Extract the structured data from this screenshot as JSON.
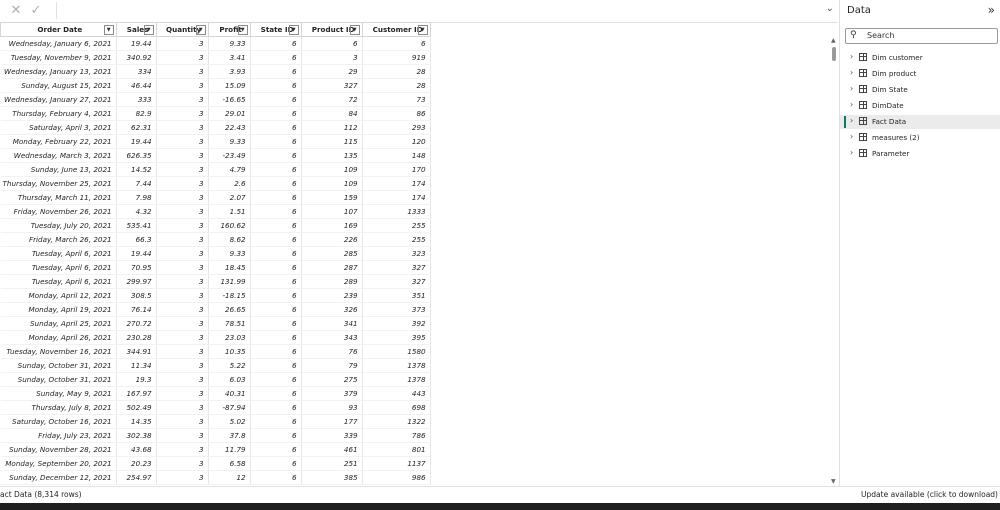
{
  "formula_bar": {
    "cancel_icon": "close-icon",
    "commit_icon": "check-icon",
    "value": ""
  },
  "table": {
    "columns": [
      "Order Date",
      "Sales",
      "Quantity",
      "Profit",
      "State ID",
      "Product ID",
      "Customer ID"
    ],
    "rows": [
      [
        "Wednesday, January 6, 2021",
        "19.44",
        "3",
        "9.33",
        "6",
        "6",
        "6"
      ],
      [
        "Tuesday, November 9, 2021",
        "340.92",
        "3",
        "3.41",
        "6",
        "3",
        "919"
      ],
      [
        "Wednesday, January 13, 2021",
        "334",
        "3",
        "3.93",
        "6",
        "29",
        "28"
      ],
      [
        "Sunday, August 15, 2021",
        "46.44",
        "3",
        "15.09",
        "6",
        "327",
        "28"
      ],
      [
        "Wednesday, January 27, 2021",
        "333",
        "3",
        "-16.65",
        "6",
        "72",
        "73"
      ],
      [
        "Thursday, February 4, 2021",
        "82.9",
        "3",
        "29.01",
        "6",
        "84",
        "86"
      ],
      [
        "Saturday, April 3, 2021",
        "62.31",
        "3",
        "22.43",
        "6",
        "112",
        "293"
      ],
      [
        "Monday, February 22, 2021",
        "19.44",
        "3",
        "9.33",
        "6",
        "115",
        "120"
      ],
      [
        "Wednesday, March 3, 2021",
        "626.35",
        "3",
        "-23.49",
        "6",
        "135",
        "148"
      ],
      [
        "Sunday, June 13, 2021",
        "14.52",
        "3",
        "4.79",
        "6",
        "109",
        "170"
      ],
      [
        "Thursday, November 25, 2021",
        "7.44",
        "3",
        "2.6",
        "6",
        "109",
        "174"
      ],
      [
        "Thursday, March 11, 2021",
        "7.98",
        "3",
        "2.07",
        "6",
        "159",
        "174"
      ],
      [
        "Friday, November 26, 2021",
        "4.32",
        "3",
        "1.51",
        "6",
        "107",
        "1333"
      ],
      [
        "Tuesday, July 20, 2021",
        "535.41",
        "3",
        "160.62",
        "6",
        "169",
        "255"
      ],
      [
        "Friday, March 26, 2021",
        "66.3",
        "3",
        "8.62",
        "6",
        "226",
        "255"
      ],
      [
        "Tuesday, April 6, 2021",
        "19.44",
        "3",
        "9.33",
        "6",
        "285",
        "323"
      ],
      [
        "Tuesday, April 6, 2021",
        "70.95",
        "3",
        "18.45",
        "6",
        "287",
        "327"
      ],
      [
        "Tuesday, April 6, 2021",
        "299.97",
        "3",
        "131.99",
        "6",
        "289",
        "327"
      ],
      [
        "Monday, April 12, 2021",
        "308.5",
        "3",
        "-18.15",
        "6",
        "239",
        "351"
      ],
      [
        "Monday, April 19, 2021",
        "76.14",
        "3",
        "26.65",
        "6",
        "326",
        "373"
      ],
      [
        "Sunday, April 25, 2021",
        "270.72",
        "3",
        "78.51",
        "6",
        "341",
        "392"
      ],
      [
        "Monday, April 26, 2021",
        "230.28",
        "3",
        "23.03",
        "6",
        "343",
        "395"
      ],
      [
        "Tuesday, November 16, 2021",
        "344.91",
        "3",
        "10.35",
        "6",
        "76",
        "1580"
      ],
      [
        "Sunday, October 31, 2021",
        "11.34",
        "3",
        "5.22",
        "6",
        "79",
        "1378"
      ],
      [
        "Sunday, October 31, 2021",
        "19.3",
        "3",
        "6.03",
        "6",
        "275",
        "1378"
      ],
      [
        "Sunday, May 9, 2021",
        "167.97",
        "3",
        "40.31",
        "6",
        "379",
        "443"
      ],
      [
        "Thursday, July 8, 2021",
        "502.49",
        "3",
        "-87.94",
        "6",
        "93",
        "698"
      ],
      [
        "Saturday, October 16, 2021",
        "14.35",
        "3",
        "5.02",
        "6",
        "177",
        "1322"
      ],
      [
        "Friday, July 23, 2021",
        "302.38",
        "3",
        "37.8",
        "6",
        "339",
        "786"
      ],
      [
        "Sunday, November 28, 2021",
        "43.68",
        "3",
        "11.79",
        "6",
        "461",
        "801"
      ],
      [
        "Monday, September 20, 2021",
        "20.23",
        "3",
        "6.58",
        "6",
        "251",
        "1137"
      ],
      [
        "Sunday, December 12, 2021",
        "254.97",
        "3",
        "12",
        "6",
        "385",
        "986"
      ]
    ]
  },
  "data_panel": {
    "title": "Data",
    "search_placeholder": "Search",
    "items": [
      {
        "label": "Dim customer",
        "icon": "table-icon",
        "selected": false
      },
      {
        "label": "Dim product",
        "icon": "table-icon",
        "selected": false
      },
      {
        "label": "Dim State",
        "icon": "table-icon",
        "selected": false
      },
      {
        "label": "DimDate",
        "icon": "calendar-table-icon",
        "selected": false
      },
      {
        "label": "Fact Data",
        "icon": "table-icon",
        "selected": true
      },
      {
        "label": "measures (2)",
        "icon": "table-icon",
        "selected": false
      },
      {
        "label": "Parameter",
        "icon": "parameter-table-icon",
        "selected": false
      }
    ]
  },
  "status": {
    "left": "act Data (8,314 rows)",
    "right": "Update available (click to download)"
  },
  "colors": {
    "selected_accent": "#117865",
    "header_border": "#d6d6d6"
  }
}
